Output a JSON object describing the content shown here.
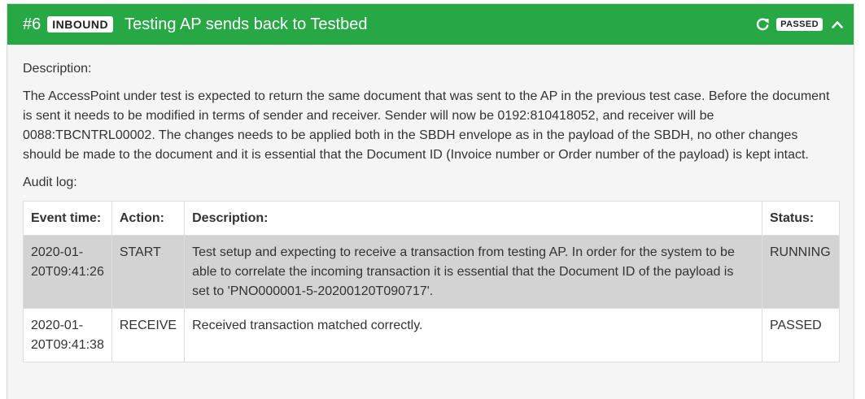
{
  "header": {
    "case_number": "#6",
    "direction": "INBOUND",
    "title": "Testing AP sends back to Testbed",
    "status": "PASSED",
    "retry_icon": "refresh-icon",
    "collapse_icon": "chevron-up-icon",
    "color": "#28a745"
  },
  "body": {
    "description_label": "Description:",
    "description_text": "The AccessPoint under test is expected to return the same document that was sent to the AP in the previous test case. Before the document is sent it needs to be modified in terms of sender and receiver. Sender will now be 0192:810418052, and receiver will be 0088:TBCNTRL00002. The changes needs to be applied both in the SBDH envelope as in the payload of the SBDH, no other changes should be made to the document and it is essential that the Document ID (Invoice number or Order number of the payload) is kept intact.",
    "audit_label": "Audit log:"
  },
  "audit_table": {
    "columns": {
      "time": "Event time:",
      "action": "Action:",
      "description": "Description:",
      "status": "Status:"
    },
    "rows": [
      {
        "time": "2020-01-20T09:41:26",
        "action": "START",
        "description": "Test setup and expecting to receive a transaction from testing AP. In order for the system to be able to correlate the incoming transaction it is essential that the Document ID of the payload is set to 'PNO000001-5-20200120T090717'.",
        "status": "RUNNING"
      },
      {
        "time": "2020-01-20T09:41:38",
        "action": "RECEIVE",
        "description": "Received transaction matched correctly.",
        "status": "PASSED"
      }
    ]
  }
}
